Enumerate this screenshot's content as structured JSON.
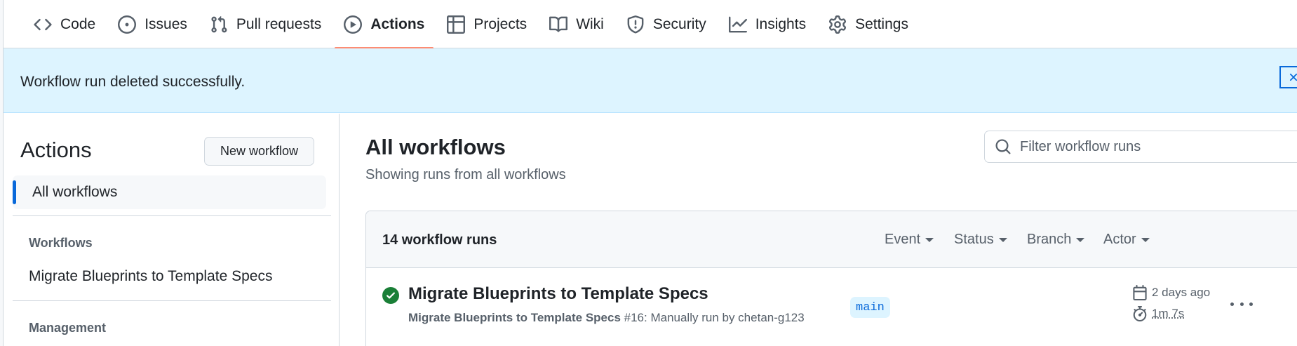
{
  "nav": {
    "tabs": [
      {
        "label": "Code",
        "icon": "code-icon"
      },
      {
        "label": "Issues",
        "icon": "issue-opened-icon"
      },
      {
        "label": "Pull requests",
        "icon": "git-pull-request-icon"
      },
      {
        "label": "Actions",
        "icon": "play-icon",
        "active": true
      },
      {
        "label": "Projects",
        "icon": "table-icon"
      },
      {
        "label": "Wiki",
        "icon": "book-icon"
      },
      {
        "label": "Security",
        "icon": "shield-icon"
      },
      {
        "label": "Insights",
        "icon": "graph-icon"
      },
      {
        "label": "Settings",
        "icon": "gear-icon"
      }
    ]
  },
  "flash": {
    "message": "Workflow run deleted successfully.",
    "close_icon": "close-icon"
  },
  "sidebar": {
    "title": "Actions",
    "new_workflow_label": "New workflow",
    "all_workflows_label": "All workflows",
    "workflows_heading": "Workflows",
    "workflows": [
      "Migrate Blueprints to Template Specs"
    ],
    "management_heading": "Management"
  },
  "main": {
    "title": "All workflows",
    "subtitle": "Showing runs from all workflows",
    "filter": {
      "placeholder": "Filter workflow runs",
      "value": ""
    },
    "runs_count": "14 workflow runs",
    "filters": [
      "Event",
      "Status",
      "Branch",
      "Actor"
    ],
    "runs": [
      {
        "status": "success",
        "title": "Migrate Blueprints to Template Specs",
        "workflow": "Migrate Blueprints to Template Specs",
        "detail": " #16: Manually run by chetan-g123",
        "branch": "main",
        "when": "2 days ago",
        "duration": "1m 7s"
      }
    ]
  },
  "colors": {
    "accent": "#0969da",
    "success": "#1a7f37",
    "active_underline": "#fd8c73",
    "flash_bg": "#ddf4ff"
  }
}
